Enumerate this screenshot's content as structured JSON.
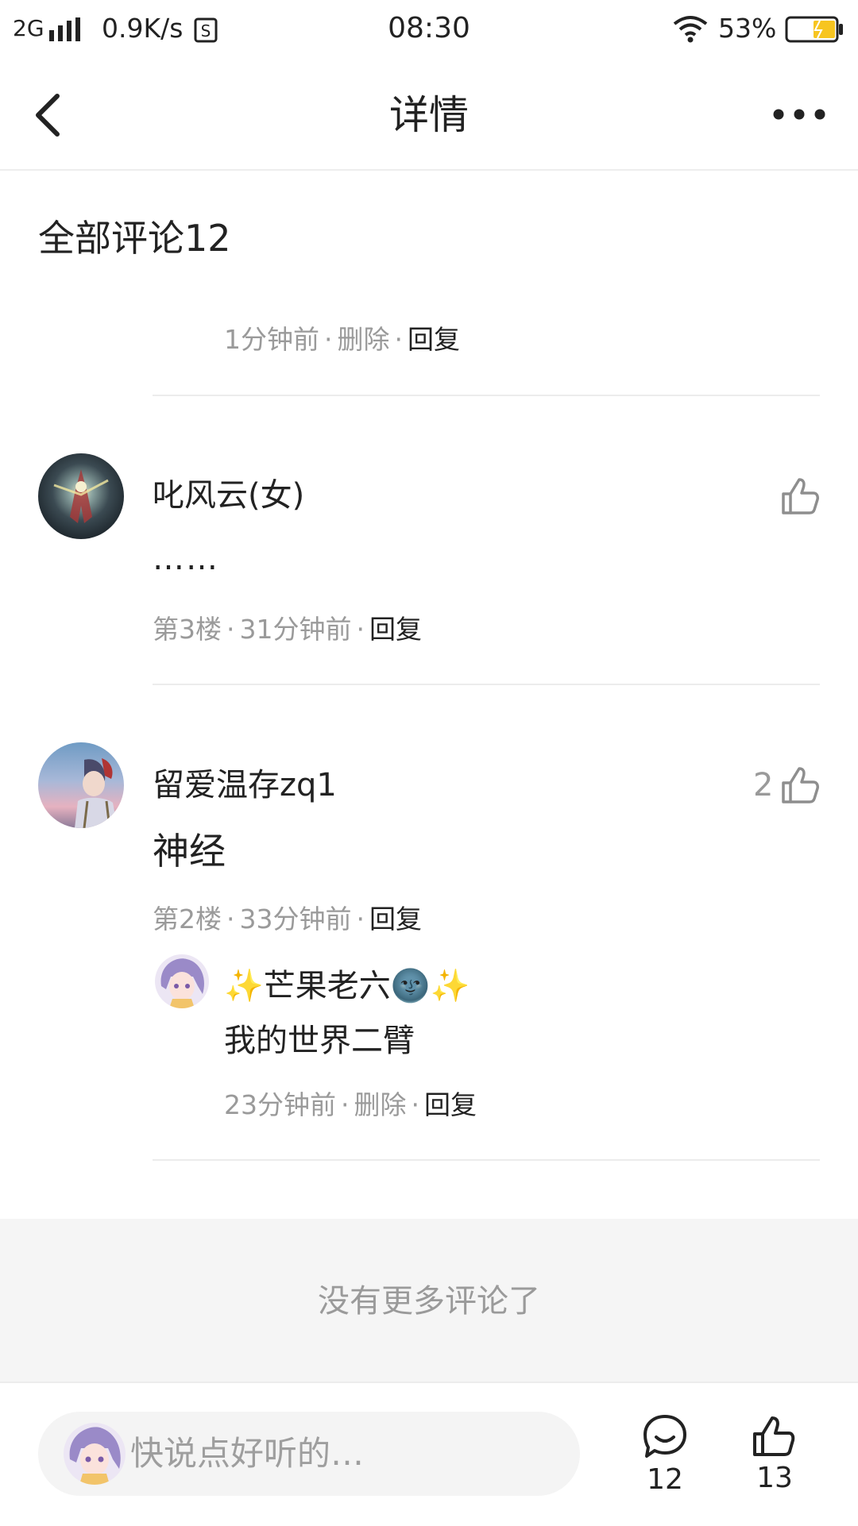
{
  "status_bar": {
    "network": "2G",
    "speed": "0.9K/s",
    "time": "08:30",
    "battery": "53%"
  },
  "nav": {
    "title": "详情",
    "back_icon": "back-arrow-icon",
    "more_icon": "more-dots-icon"
  },
  "comments_section": {
    "title": "全部评论12"
  },
  "top_partial_reply": {
    "time": "1分钟前",
    "delete": "删除",
    "reply": "回复"
  },
  "comments": [
    {
      "username": "叱风云(女)",
      "text": "……",
      "floor": "第3楼",
      "time": "31分钟前",
      "reply": "回复",
      "likes": ""
    },
    {
      "username": "留爱温存zq1",
      "text": "神经",
      "floor": "第2楼",
      "time": "33分钟前",
      "reply": "回复",
      "likes": "2",
      "sub_reply": {
        "username": "✨芒果老六🌚✨",
        "text": "我的世界二臂",
        "time": "23分钟前",
        "delete": "删除",
        "reply": "回复"
      }
    }
  ],
  "no_more": "没有更多评论了",
  "bottom_bar": {
    "placeholder": "快说点好听的…",
    "comment_count": "12",
    "like_count": "13"
  },
  "colors": {
    "text_primary": "#222222",
    "text_secondary": "#9a9a9a",
    "divider": "#ececec",
    "footer_bg": "#f5f5f5",
    "battery_fill": "#f7c520"
  }
}
